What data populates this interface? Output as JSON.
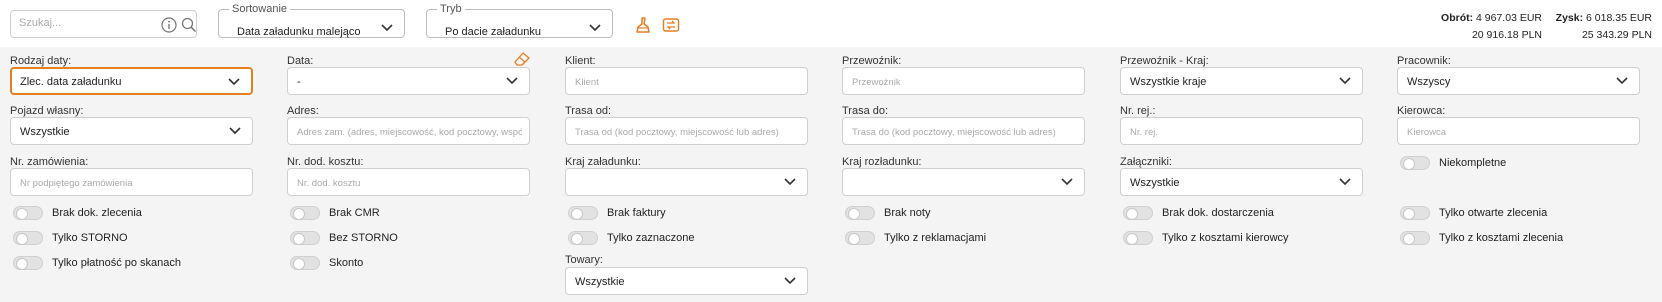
{
  "search": {
    "placeholder": "Szukaj..."
  },
  "sorting": {
    "legend": "Sortowanie",
    "value": "Data załadunku malejąco"
  },
  "mode": {
    "legend": "Tryb",
    "value": "Po dacie załadunku"
  },
  "totals": {
    "turnover_label": "Obrót:",
    "turnover_eur": "4 967.03 EUR",
    "turnover_pln": "20 916.18 PLN",
    "profit_label": "Zysk:",
    "profit_eur": "6 018.35 EUR",
    "profit_pln": "25 343.29 PLN"
  },
  "fields": {
    "date_type": {
      "label": "Rodzaj daty:",
      "value": "Zlec. data załadunku"
    },
    "date": {
      "label": "Data:",
      "value": "-"
    },
    "client": {
      "label": "Klient:",
      "placeholder": "Klient"
    },
    "carrier": {
      "label": "Przewoźnik:",
      "placeholder": "Przewoźnik"
    },
    "carrier_country": {
      "label": "Przewoźnik - Kraj:",
      "value": "Wszystkie kraje"
    },
    "employee": {
      "label": "Pracownik:",
      "value": "Wszyscy"
    },
    "own_vehicle": {
      "label": "Pojazd własny:",
      "value": "Wszystkie"
    },
    "address": {
      "label": "Adres:",
      "placeholder": "Adres zam. (adres, miejscowość, kod pocztowy, współrzędn"
    },
    "route_from": {
      "label": "Trasa od:",
      "placeholder": "Trasa od (kod pocztowy, miejscowość lub adres)"
    },
    "route_to": {
      "label": "Trasa do:",
      "placeholder": "Trasa do (kod pocztowy, miejscowość lub adres)"
    },
    "reg_no": {
      "label": "Nr. rej.:",
      "placeholder": "Nr. rej."
    },
    "driver": {
      "label": "Kierowca:",
      "placeholder": "Kierowca"
    },
    "order_no": {
      "label": "Nr. zamówienia:",
      "placeholder": "Nr podpiętego zamówienia"
    },
    "extra_cost_no": {
      "label": "Nr. dod. kosztu:",
      "placeholder": "Nr. dod. kosztu"
    },
    "loading_country": {
      "label": "Kraj załadunku:",
      "value": ""
    },
    "unloading_country": {
      "label": "Kraj rozładunku:",
      "value": ""
    },
    "attachments": {
      "label": "Załączniki:",
      "value": "Wszystkie"
    },
    "goods": {
      "label": "Towary:",
      "value": "Wszystkie"
    }
  },
  "toggles": {
    "incomplete": "Niekompletne",
    "no_order_doc": "Brak dok. zlecenia",
    "no_cmr": "Brak CMR",
    "no_invoice": "Brak faktury",
    "no_note": "Brak noty",
    "no_delivery_doc": "Brak dok. dostarczenia",
    "only_open": "Tylko otwarte zlecenia",
    "only_storno": "Tylko STORNO",
    "without_storno": "Bez STORNO",
    "only_marked": "Tylko zaznaczone",
    "only_complaints": "Tylko z reklamacjami",
    "only_driver_costs": "Tylko z kosztami kierowcy",
    "only_order_costs": "Tylko z kosztami zlecenia",
    "only_scan_payment": "Tylko płatność po skanach",
    "discount": "Skonto"
  },
  "colors": {
    "accent": "#e67e22",
    "panel": "#f4f4f4"
  }
}
